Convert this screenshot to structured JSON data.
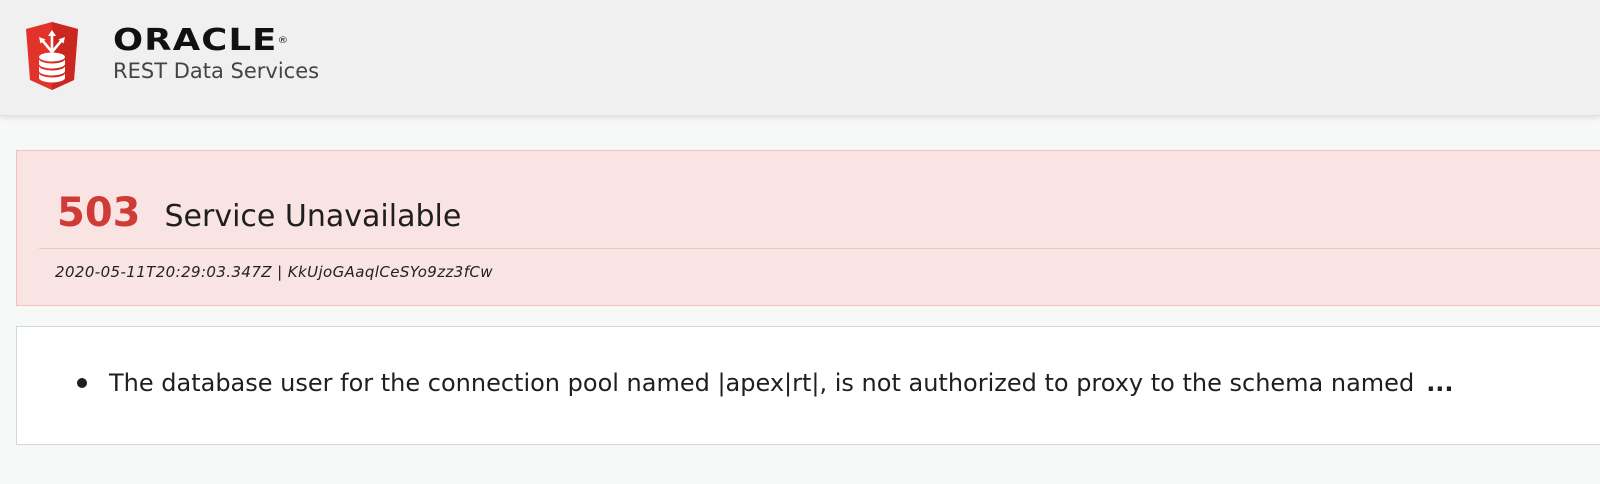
{
  "header": {
    "brand_name": "ORACLE",
    "brand_mark": "®",
    "product_name": "REST Data Services",
    "logo_icon": "database-shield-icon",
    "brand_color": "#e2332a"
  },
  "error": {
    "code": "503",
    "message": "Service Unavailable",
    "meta": "2020-05-11T20:29:03.347Z | KkUjoGAaqlCeSYo9zz3fCw",
    "code_color": "#cf3b35",
    "background_color": "#fae3e3"
  },
  "details": {
    "items": [
      {
        "text": "The database user for the connection pool named |apex|rt|, is not authorized to proxy to the schema named",
        "truncation": "..."
      }
    ]
  }
}
